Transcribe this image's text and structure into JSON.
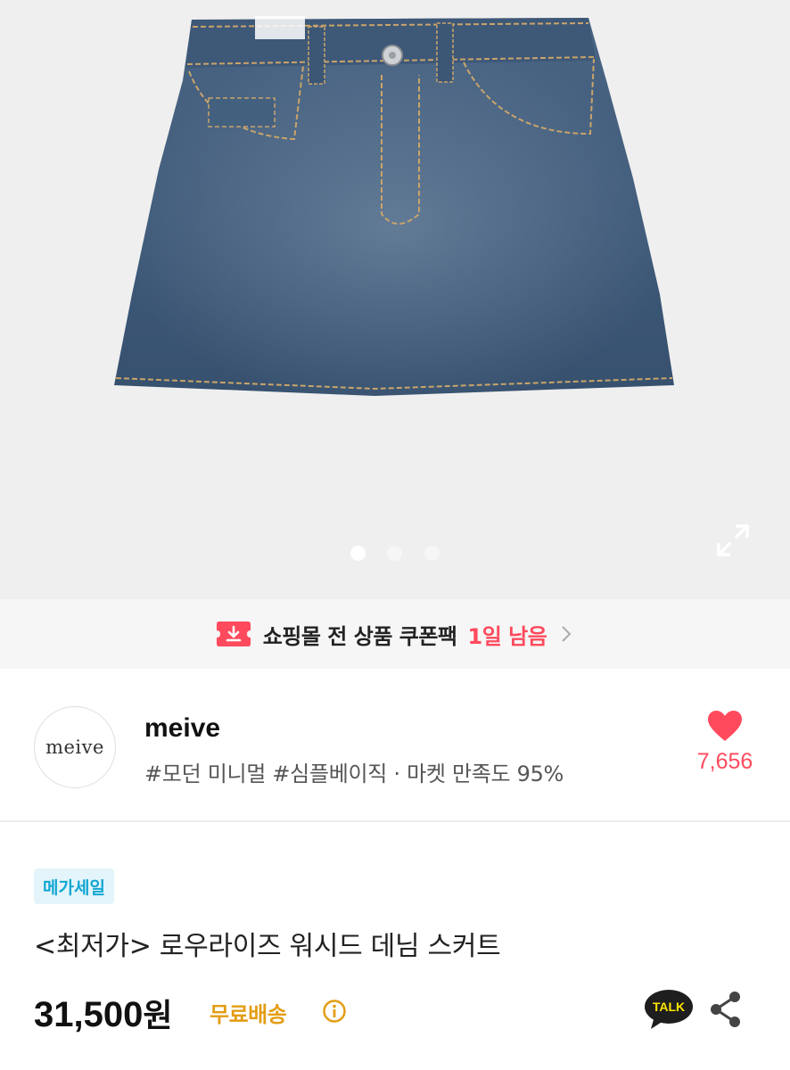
{
  "product_image": {
    "alt": "",
    "slide_count": 3,
    "active_slide": 1
  },
  "coupon": {
    "text": "쇼핑몰 전 상품 쿠폰팩",
    "remaining": "1일 남음",
    "accent_color": "#ff4a5d"
  },
  "store": {
    "logo_text": "meive",
    "name": "meive",
    "tags": "#모던 미니멀 #심플베이직 · 마켓 만족도 95%",
    "like_count": "7,656"
  },
  "product": {
    "badge": "메가세일",
    "title": "<최저가> 로우라이즈 워시드 데님 스커트",
    "price": "31,500",
    "price_unit": "원",
    "shipping": "무료배송"
  },
  "actions": {
    "talk_label": "TALK"
  },
  "icons": {
    "expand": "expand-icon",
    "coupon": "coupon-download-icon",
    "chevron": "chevron-right-icon",
    "heart": "heart-icon",
    "info": "info-icon",
    "talk": "kakao-talk-icon",
    "share": "share-icon"
  }
}
